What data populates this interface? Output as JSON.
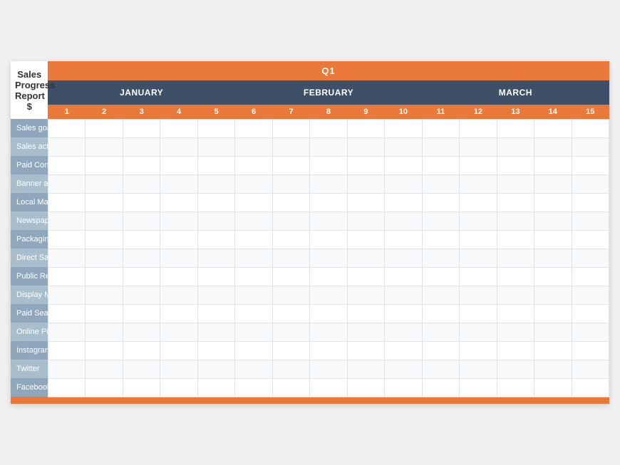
{
  "title": {
    "line1": "Sales Progress",
    "line2": "Report $"
  },
  "quarter": "Q1",
  "months": [
    {
      "name": "JANUARY",
      "span": 5
    },
    {
      "name": "FEBRUARY",
      "span": 5
    },
    {
      "name": "MARCH",
      "span": 5
    }
  ],
  "days": [
    1,
    2,
    3,
    4,
    5,
    6,
    7,
    8,
    9,
    10,
    11,
    12,
    13,
    14,
    15
  ],
  "rows": [
    "Sales goal",
    "Sales actual",
    "Paid Content",
    "Banner ads",
    "Local Marketing",
    "Newspaper",
    "Packaging",
    "Direct Sales",
    "Public Relations",
    "Display Marketing",
    "Paid Search",
    "Online PR",
    "Instagram",
    "Twitter",
    "Facebook"
  ]
}
